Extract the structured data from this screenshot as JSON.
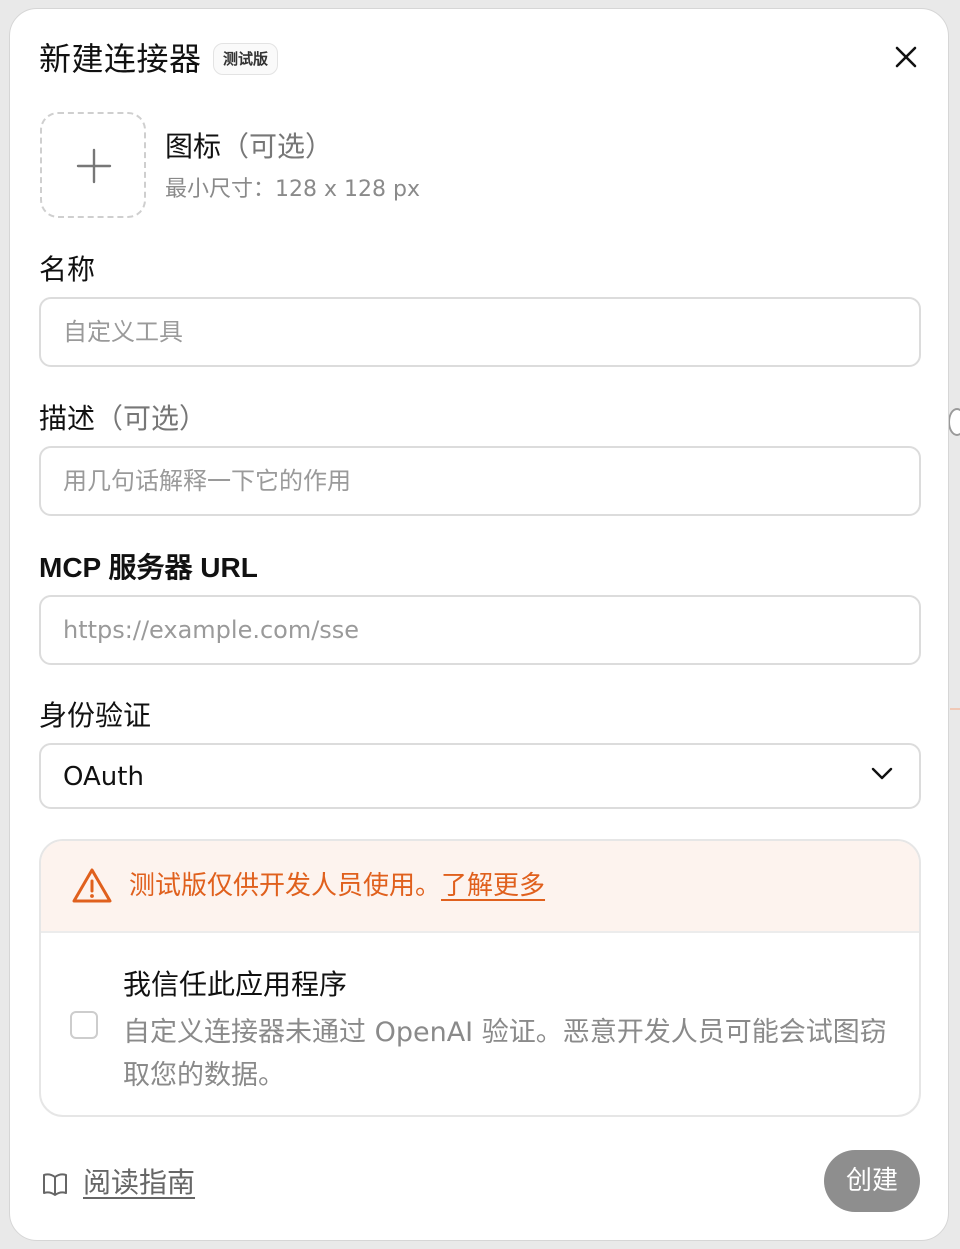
{
  "dialog": {
    "title": "新建连接器",
    "beta_tag": "测试版"
  },
  "icon_field": {
    "label": "图标",
    "optional": "（可选）",
    "hint": "最小尺寸：128 x 128 px"
  },
  "name_field": {
    "label": "名称",
    "placeholder": "自定义工具",
    "value": ""
  },
  "description_field": {
    "label": "描述",
    "optional": "（可选）",
    "placeholder": "用几句话解释一下它的作用",
    "value": ""
  },
  "url_field": {
    "label": "MCP 服务器 URL",
    "placeholder": "https://example.com/sse",
    "value": ""
  },
  "auth_field": {
    "label": "身份验证",
    "selected": "OAuth"
  },
  "warning": {
    "text": "测试版仅供开发人员使用。",
    "link": "了解更多",
    "color": "#e0601d",
    "background": "#fdf3ee"
  },
  "trust": {
    "checked": false,
    "title": "我信任此应用程序",
    "description": "自定义连接器未通过 OpenAI 验证。恶意开发人员可能会试图窃取您的数据。"
  },
  "footer": {
    "guide_link": "阅读指南",
    "create_button": "创建"
  },
  "icons": {
    "close": "close-icon",
    "plus": "plus-icon",
    "chevron": "chevron-down-icon",
    "warning": "warning-triangle-icon",
    "book": "book-open-icon"
  }
}
